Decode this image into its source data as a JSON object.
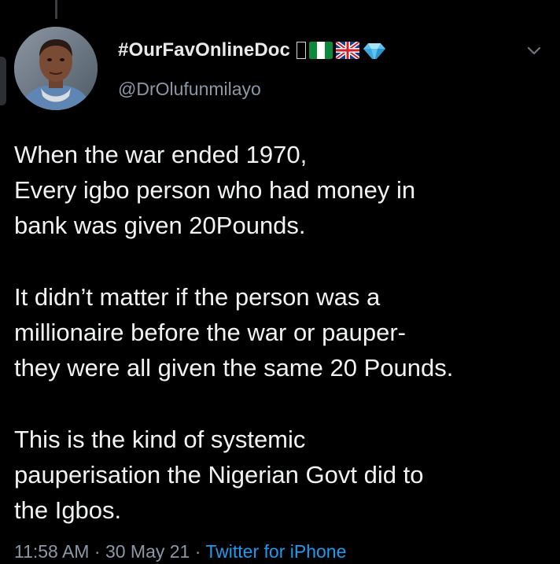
{
  "tweet": {
    "author": {
      "display_name": "#OurFavOnlineDoc",
      "handle": "@DrOlufunmilayo",
      "name_emojis": [
        "missing-glyph",
        "nigeria-flag",
        "uk-flag",
        "gem"
      ]
    },
    "paragraphs": [
      [
        "When the war ended 1970,",
        "Every igbo person who had money in",
        "bank was given 20Pounds."
      ],
      [
        "It didn’t matter if the person was a",
        "millionaire before the war or pauper-",
        "they were all given the same 20 Pounds."
      ],
      [
        "This is the kind of systemic",
        "pauperisation the Nigerian Govt did to",
        "the Igbos."
      ]
    ],
    "time": "11:58 AM",
    "date": "30 May 21",
    "separator": "·",
    "source": "Twitter for iPhone"
  },
  "icons": {
    "menu": "chevron-down-icon",
    "avatar": "profile-photo"
  },
  "colors": {
    "background": "#000000",
    "text": "#e7e9ea",
    "secondary": "#8b98a5",
    "link": "#1d9bf0"
  }
}
